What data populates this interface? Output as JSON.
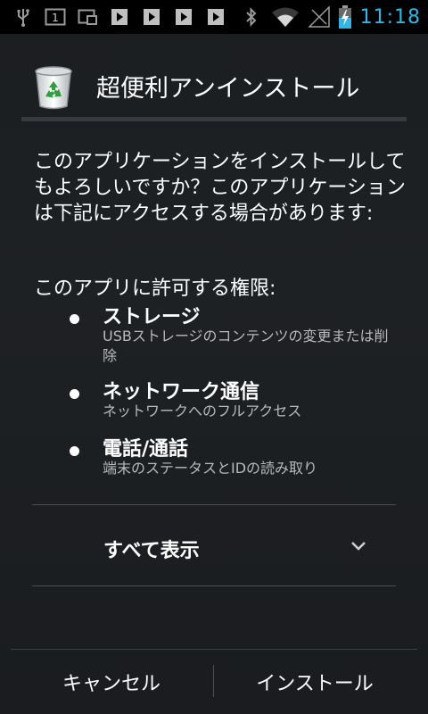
{
  "status_bar": {
    "left_icons": [
      "usb-icon",
      "notification-count-icon",
      "screenshot-icon",
      "play-store-icon",
      "play-store-icon",
      "play-store-icon",
      "play-store-icon"
    ],
    "notification_count": "1",
    "right_icons": [
      "bluetooth-icon",
      "wifi-icon",
      "signal-icon",
      "battery-charging-icon"
    ],
    "time": "11:18",
    "accent_color": "#33b5e5"
  },
  "app": {
    "title": "超便利アンインストール",
    "icon": "recycle-bin-icon"
  },
  "content": {
    "description": "このアプリケーションをインストールしてもよろしいですか？このアプリケーションは下記にアクセスする場合があります:",
    "permissions_heading": "このアプリに許可する権限:",
    "permissions": [
      {
        "title": "ストレージ",
        "desc": "USBストレージのコンテンツの変更または削除"
      },
      {
        "title": "ネットワーク通信",
        "desc": "ネットワークへのフルアクセス"
      },
      {
        "title": "電話/通話",
        "desc": "端末のステータスとIDの読み取り"
      }
    ],
    "show_all_label": "すべて表示"
  },
  "buttons": {
    "cancel": "キャンセル",
    "install": "インストール"
  }
}
